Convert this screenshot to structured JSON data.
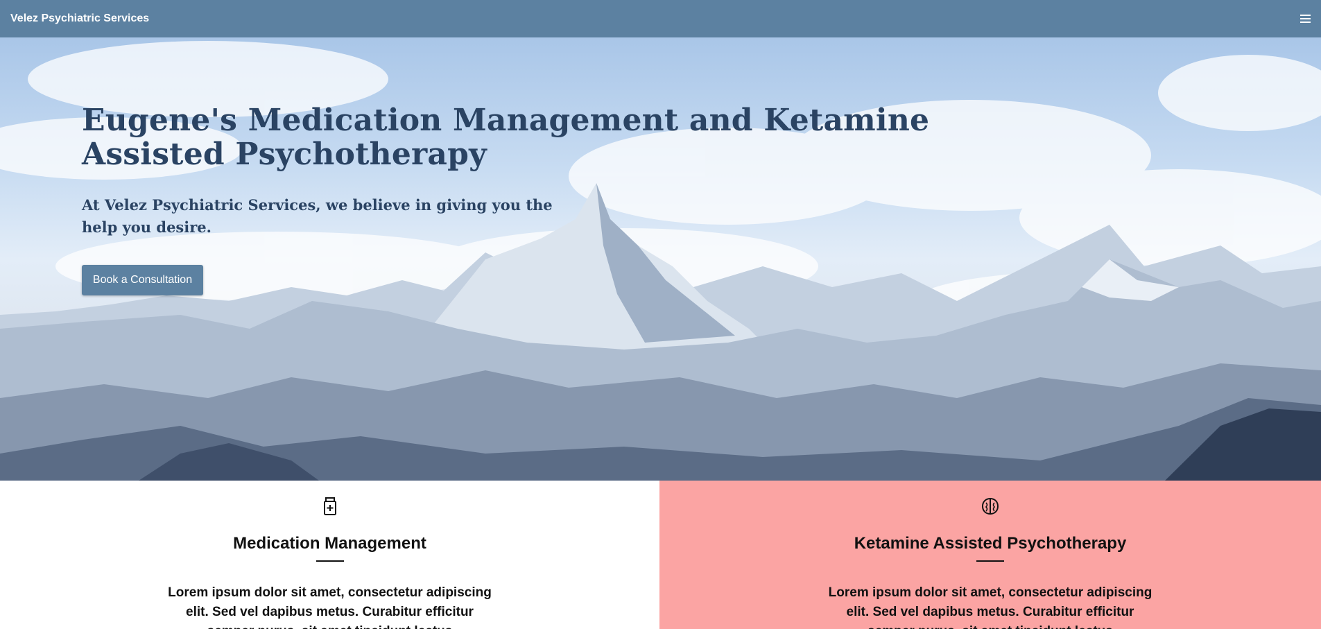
{
  "navbar": {
    "brand": "Velez Psychiatric Services",
    "menu_icon": "hamburger-menu-icon"
  },
  "hero": {
    "title": "Eugene's Medication Management and Ketamine Assisted Psychotherapy",
    "subtitle": "At Velez Psychiatric Services, we believe in giving you the help you desire.",
    "cta_label": "Book a Consultation",
    "background": "snowy-mountain-range-photo"
  },
  "services": [
    {
      "icon": "medicine-bottle-icon",
      "title": "Medication Management",
      "text": "Lorem ipsum dolor sit amet, consectetur adipiscing elit. Sed vel dapibus metus. Curabitur efficitur semper purus, sit amet tincidunt lectus"
    },
    {
      "icon": "brain-icon",
      "title": "Ketamine Assisted Psychotherapy",
      "text": "Lorem ipsum dolor sit amet, consectetur adipiscing elit. Sed vel dapibus metus. Curabitur efficitur semper purus, sit amet tincidunt lectus"
    }
  ],
  "colors": {
    "navbar": "#5c81a1",
    "heading": "#2a4363",
    "button": "#5c81a1",
    "accent_panel": "#fba4a3"
  }
}
